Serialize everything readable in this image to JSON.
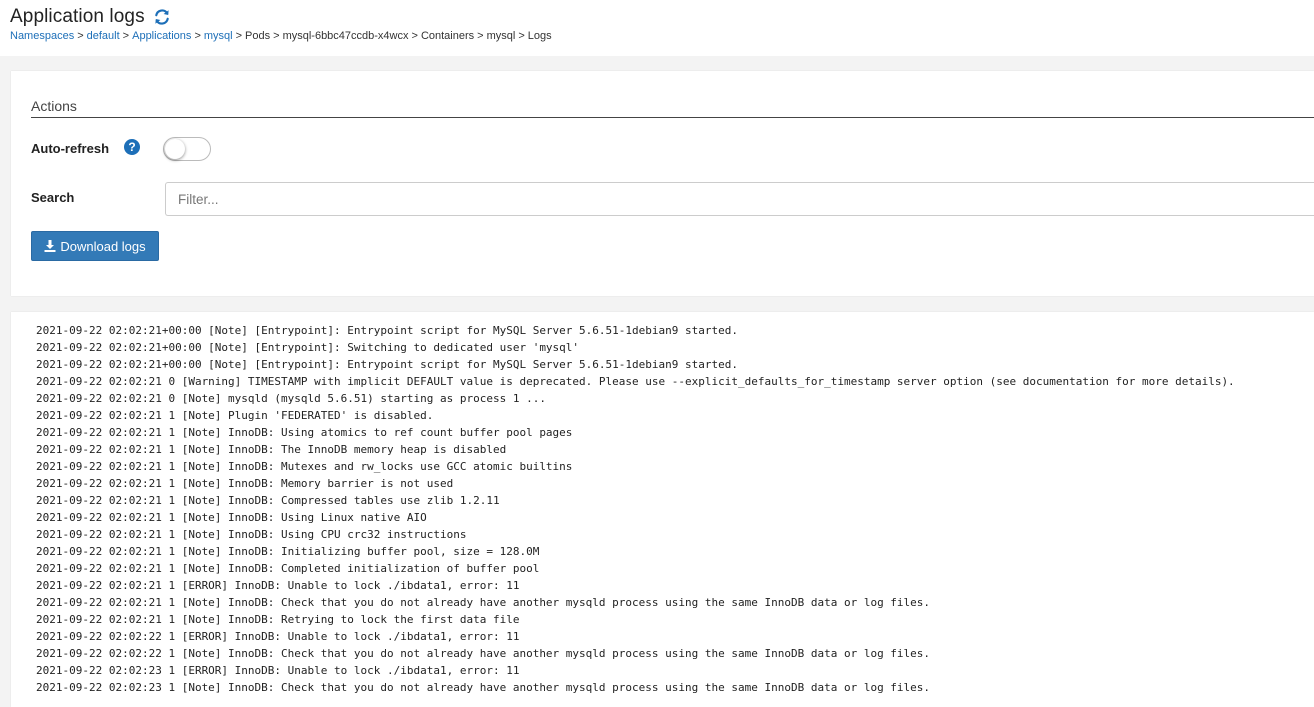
{
  "header": {
    "title": "Application logs",
    "breadcrumb": [
      {
        "label": "Namespaces",
        "link": true
      },
      {
        "label": "default",
        "link": true
      },
      {
        "label": "Applications",
        "link": true
      },
      {
        "label": "mysql",
        "link": true
      },
      {
        "label": "Pods",
        "link": false
      },
      {
        "label": "mysql-6bbc47ccdb-x4wcx",
        "link": false
      },
      {
        "label": "Containers",
        "link": false
      },
      {
        "label": "mysql",
        "link": false
      },
      {
        "label": "Logs",
        "link": false
      }
    ]
  },
  "actions": {
    "section_title": "Actions",
    "auto_refresh_label": "Auto-refresh",
    "auto_refresh_on": false,
    "help_glyph": "?",
    "search_label": "Search",
    "search_placeholder": "Filter...",
    "search_value": "",
    "download_label": "Download logs"
  },
  "colors": {
    "accent": "#1d6fb8",
    "button": "#337ab7"
  },
  "icons": {
    "refresh": "refresh-icon",
    "help": "help-icon",
    "download": "download-icon"
  },
  "logs": [
    "2021-09-22 02:02:21+00:00 [Note] [Entrypoint]: Entrypoint script for MySQL Server 5.6.51-1debian9 started.",
    "2021-09-22 02:02:21+00:00 [Note] [Entrypoint]: Switching to dedicated user 'mysql'",
    "2021-09-22 02:02:21+00:00 [Note] [Entrypoint]: Entrypoint script for MySQL Server 5.6.51-1debian9 started.",
    "2021-09-22 02:02:21 0 [Warning] TIMESTAMP with implicit DEFAULT value is deprecated. Please use --explicit_defaults_for_timestamp server option (see documentation for more details).",
    "2021-09-22 02:02:21 0 [Note] mysqld (mysqld 5.6.51) starting as process 1 ...",
    "2021-09-22 02:02:21 1 [Note] Plugin 'FEDERATED' is disabled.",
    "2021-09-22 02:02:21 1 [Note] InnoDB: Using atomics to ref count buffer pool pages",
    "2021-09-22 02:02:21 1 [Note] InnoDB: The InnoDB memory heap is disabled",
    "2021-09-22 02:02:21 1 [Note] InnoDB: Mutexes and rw_locks use GCC atomic builtins",
    "2021-09-22 02:02:21 1 [Note] InnoDB: Memory barrier is not used",
    "2021-09-22 02:02:21 1 [Note] InnoDB: Compressed tables use zlib 1.2.11",
    "2021-09-22 02:02:21 1 [Note] InnoDB: Using Linux native AIO",
    "2021-09-22 02:02:21 1 [Note] InnoDB: Using CPU crc32 instructions",
    "2021-09-22 02:02:21 1 [Note] InnoDB: Initializing buffer pool, size = 128.0M",
    "2021-09-22 02:02:21 1 [Note] InnoDB: Completed initialization of buffer pool",
    "2021-09-22 02:02:21 1 [ERROR] InnoDB: Unable to lock ./ibdata1, error: 11",
    "2021-09-22 02:02:21 1 [Note] InnoDB: Check that you do not already have another mysqld process using the same InnoDB data or log files.",
    "2021-09-22 02:02:21 1 [Note] InnoDB: Retrying to lock the first data file",
    "2021-09-22 02:02:22 1 [ERROR] InnoDB: Unable to lock ./ibdata1, error: 11",
    "2021-09-22 02:02:22 1 [Note] InnoDB: Check that you do not already have another mysqld process using the same InnoDB data or log files.",
    "2021-09-22 02:02:23 1 [ERROR] InnoDB: Unable to lock ./ibdata1, error: 11",
    "2021-09-22 02:02:23 1 [Note] InnoDB: Check that you do not already have another mysqld process using the same InnoDB data or log files."
  ]
}
